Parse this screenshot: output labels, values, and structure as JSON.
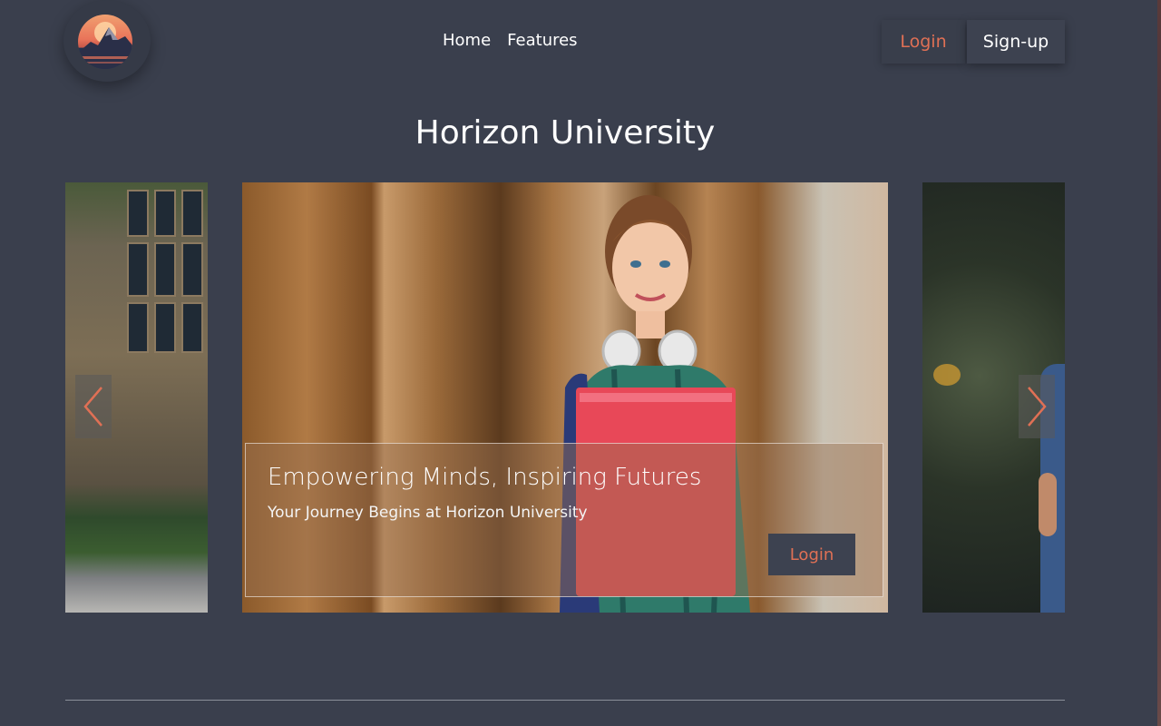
{
  "header": {
    "logo_icon": "mountain-sunset-logo",
    "nav": [
      "Home",
      "Features"
    ],
    "login_label": "Login",
    "signup_label": "Sign-up"
  },
  "page_title": "Horizon University",
  "carousel": {
    "caption": {
      "headline": "Empowering Minds, Inspiring Futures",
      "subtitle": "Your Journey Begins at Horizon University",
      "button_label": "Login"
    },
    "prev_icon": "chevron-left-icon",
    "next_icon": "chevron-right-icon"
  },
  "colors": {
    "background": "#3a3f4d",
    "accent": "#e07055",
    "text": "#ffffff"
  }
}
